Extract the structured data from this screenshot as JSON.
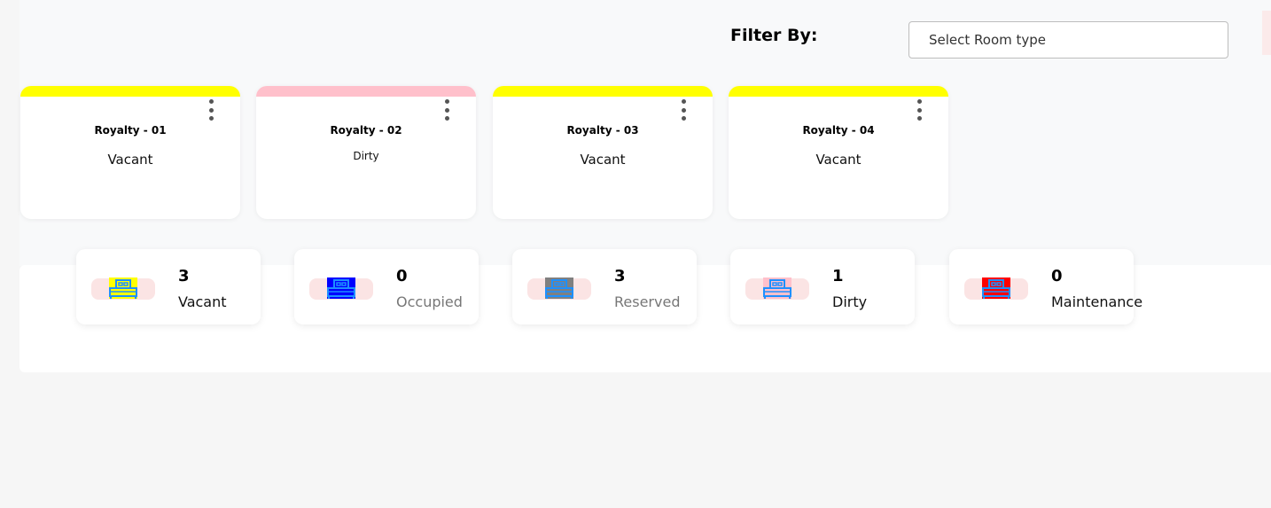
{
  "filter": {
    "label": "Filter By:",
    "select_placeholder": "Select Room type"
  },
  "rooms": [
    {
      "name": "Royalty - 01",
      "status": "Vacant",
      "bar_color": "#ffff00"
    },
    {
      "name": "Royalty - 02",
      "status": "Dirty",
      "bar_color": "#ffc0cb"
    },
    {
      "name": "Royalty - 03",
      "status": "Vacant",
      "bar_color": "#ffff00"
    },
    {
      "name": "Royalty - 04",
      "status": "Vacant",
      "bar_color": "#ffff00"
    }
  ],
  "summary": [
    {
      "count": "3",
      "label": "Vacant",
      "bed_color": "#ffff00",
      "label_color": "#111111"
    },
    {
      "count": "0",
      "label": "Occupied",
      "bed_color": "#0000ff",
      "label_color": "#777777"
    },
    {
      "count": "3",
      "label": "Reserved",
      "bed_color": "#808080",
      "label_color": "#777777"
    },
    {
      "count": "1",
      "label": "Dirty",
      "bed_color": "#ffc0cb",
      "label_color": "#111111"
    },
    {
      "count": "0",
      "label": "Maintenance",
      "bed_color": "#ff0000",
      "label_color": "#111111"
    }
  ],
  "icons": {
    "room_menu": "kebab-menu-icon",
    "status_bed": "bed-icon"
  }
}
